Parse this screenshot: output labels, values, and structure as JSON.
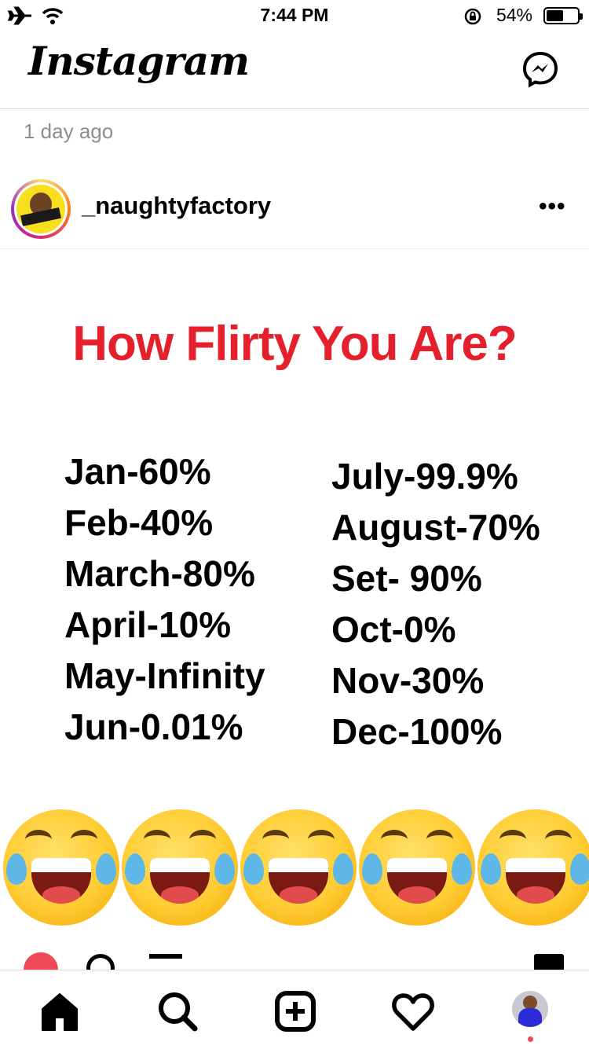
{
  "status_bar": {
    "time": "7:44 PM",
    "battery_pct": "54%",
    "battery_level": 0.54
  },
  "header": {
    "logo": "Instagram"
  },
  "post": {
    "time_ago": "1 day ago",
    "username": "_naughtyfactory",
    "more_icon": "ellipsis-icon",
    "image": {
      "headline": "How Flirty You Are?",
      "left_column": [
        "Jan-60%",
        "Feb-40%",
        "March-80%",
        "April-10%",
        "May-Infinity",
        "Jun-0.01%"
      ],
      "right_column": [
        "July-99.9%",
        "August-70%",
        "Set- 90%",
        "Oct-0%",
        "Nov-30%",
        "Dec-100%"
      ],
      "emoji": "face-with-tears-of-joy",
      "emoji_count": 5
    },
    "actions": [
      "heart-icon",
      "comment-icon",
      "share-icon",
      "save-icon"
    ]
  },
  "nav": {
    "items": [
      "home-icon",
      "search-icon",
      "new-post-icon",
      "activity-icon",
      "profile-avatar"
    ]
  },
  "colors": {
    "headline_red": "#e4202c",
    "like_red": "#ed4956",
    "muted": "#8e8e8e",
    "divider": "#dbdbdb"
  }
}
